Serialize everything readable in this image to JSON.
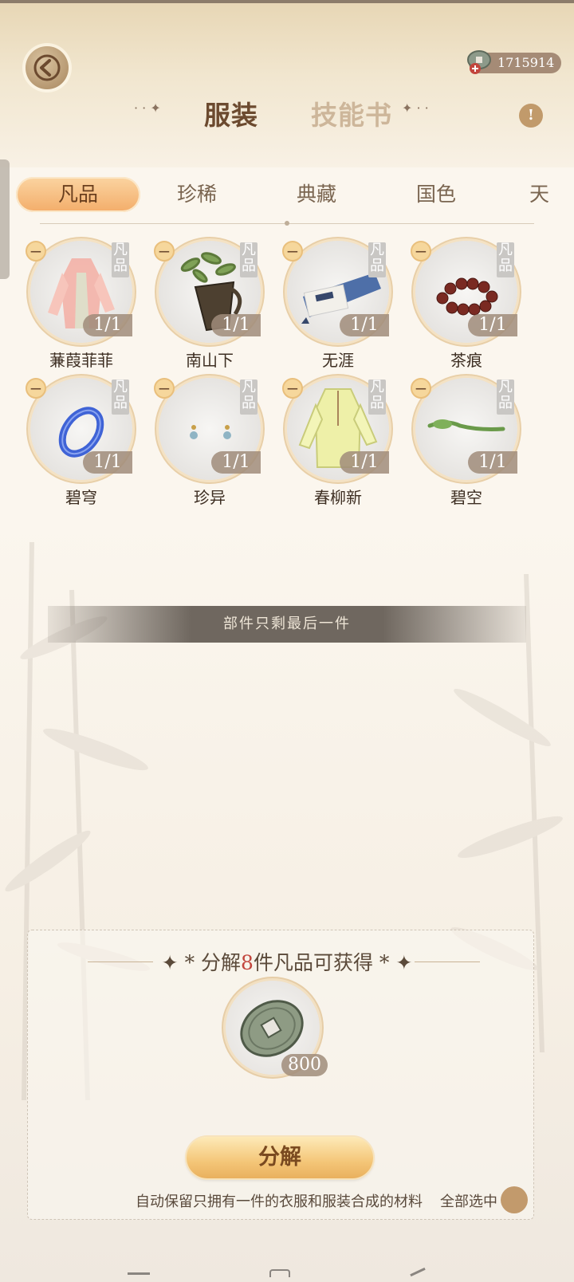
{
  "header": {
    "back_icon": "back-arrow-icon",
    "currency_value": "1715914",
    "currency_icon": "coin-plus-icon",
    "help_icon": "exclamation-icon",
    "tabs": [
      {
        "label": "服装",
        "active": true
      },
      {
        "label": "技能书",
        "active": false
      }
    ]
  },
  "rarity_tabs": [
    {
      "label": "凡品",
      "active": true
    },
    {
      "label": "珍稀",
      "active": false
    },
    {
      "label": "典藏",
      "active": false
    },
    {
      "label": "国色",
      "active": false
    },
    {
      "label": "天",
      "active": false
    }
  ],
  "items": [
    {
      "name": "蒹葭菲菲",
      "grade": "凡品",
      "count": "1/1",
      "icon": "robe-icon"
    },
    {
      "name": "南山下",
      "grade": "凡品",
      "count": "1/1",
      "icon": "plant-basket-icon"
    },
    {
      "name": "无涯",
      "grade": "凡品",
      "count": "1/1",
      "icon": "scroll-book-icon"
    },
    {
      "name": "茶痕",
      "grade": "凡品",
      "count": "1/1",
      "icon": "bead-bracelet-icon"
    },
    {
      "name": "碧穹",
      "grade": "凡品",
      "count": "1/1",
      "icon": "bangle-icon"
    },
    {
      "name": "珍异",
      "grade": "凡品",
      "count": "1/1",
      "icon": "earrings-icon"
    },
    {
      "name": "春柳新",
      "grade": "凡品",
      "count": "1/1",
      "icon": "jacket-icon"
    },
    {
      "name": "碧空",
      "grade": "凡品",
      "count": "1/1",
      "icon": "hairpin-icon"
    }
  ],
  "banner": {
    "text": "部件只剩最后一件"
  },
  "decompose": {
    "title_prefix": "分解",
    "title_number": "8",
    "title_suffix": "件凡品可获得",
    "reward_count": "800",
    "reward_icon": "copper-coin-icon",
    "button_label": "分解",
    "note": "自动保留只拥有一件的衣服和服装合成的材料",
    "select_all_label": "全部选中"
  },
  "colors": {
    "accent": "#f3ad6a",
    "count_badge": "#a08c7a",
    "highlight_number": "#c2453d"
  }
}
